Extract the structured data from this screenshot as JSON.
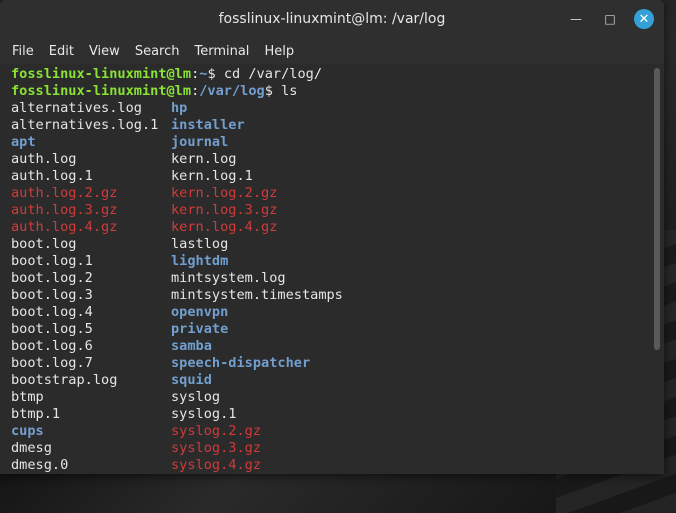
{
  "window": {
    "title": "fosslinux-linuxmint@lm: /var/log",
    "controls": {
      "minimize": "—",
      "maximize": "□",
      "close": "✕"
    }
  },
  "menu": [
    "File",
    "Edit",
    "View",
    "Search",
    "Terminal",
    "Help"
  ],
  "prompts": [
    {
      "user": "fosslinux-linuxmint@lm",
      "sep": ":",
      "path": "~",
      "symbol": "$ ",
      "command": "cd /var/log/"
    },
    {
      "user": "fosslinux-linuxmint@lm",
      "sep": ":",
      "path": "/var/log",
      "symbol": "$ ",
      "command": "ls"
    }
  ],
  "listing": [
    [
      {
        "name": "alternatives.log",
        "type": "file"
      },
      {
        "name": "hp",
        "type": "dir"
      }
    ],
    [
      {
        "name": "alternatives.log.1",
        "type": "file"
      },
      {
        "name": "installer",
        "type": "dir"
      }
    ],
    [
      {
        "name": "apt",
        "type": "dir"
      },
      {
        "name": "journal",
        "type": "dir"
      }
    ],
    [
      {
        "name": "auth.log",
        "type": "file"
      },
      {
        "name": "kern.log",
        "type": "file"
      }
    ],
    [
      {
        "name": "auth.log.1",
        "type": "file"
      },
      {
        "name": "kern.log.1",
        "type": "file"
      }
    ],
    [
      {
        "name": "auth.log.2.gz",
        "type": "gz"
      },
      {
        "name": "kern.log.2.gz",
        "type": "gz"
      }
    ],
    [
      {
        "name": "auth.log.3.gz",
        "type": "gz"
      },
      {
        "name": "kern.log.3.gz",
        "type": "gz"
      }
    ],
    [
      {
        "name": "auth.log.4.gz",
        "type": "gz"
      },
      {
        "name": "kern.log.4.gz",
        "type": "gz"
      }
    ],
    [
      {
        "name": "boot.log",
        "type": "file"
      },
      {
        "name": "lastlog",
        "type": "file"
      }
    ],
    [
      {
        "name": "boot.log.1",
        "type": "file"
      },
      {
        "name": "lightdm",
        "type": "dir"
      }
    ],
    [
      {
        "name": "boot.log.2",
        "type": "file"
      },
      {
        "name": "mintsystem.log",
        "type": "file"
      }
    ],
    [
      {
        "name": "boot.log.3",
        "type": "file"
      },
      {
        "name": "mintsystem.timestamps",
        "type": "file"
      }
    ],
    [
      {
        "name": "boot.log.4",
        "type": "file"
      },
      {
        "name": "openvpn",
        "type": "dir"
      }
    ],
    [
      {
        "name": "boot.log.5",
        "type": "file"
      },
      {
        "name": "private",
        "type": "dir"
      }
    ],
    [
      {
        "name": "boot.log.6",
        "type": "file"
      },
      {
        "name": "samba",
        "type": "dir"
      }
    ],
    [
      {
        "name": "boot.log.7",
        "type": "file"
      },
      {
        "name": "speech-dispatcher",
        "type": "dir"
      }
    ],
    [
      {
        "name": "bootstrap.log",
        "type": "file"
      },
      {
        "name": "squid",
        "type": "dir"
      }
    ],
    [
      {
        "name": "btmp",
        "type": "file"
      },
      {
        "name": "syslog",
        "type": "file"
      }
    ],
    [
      {
        "name": "btmp.1",
        "type": "file"
      },
      {
        "name": "syslog.1",
        "type": "file"
      }
    ],
    [
      {
        "name": "cups",
        "type": "dir"
      },
      {
        "name": "syslog.2.gz",
        "type": "gz"
      }
    ],
    [
      {
        "name": "dmesg",
        "type": "file"
      },
      {
        "name": "syslog.3.gz",
        "type": "gz"
      }
    ],
    [
      {
        "name": "dmesg.0",
        "type": "file"
      },
      {
        "name": "syslog.4.gz",
        "type": "gz"
      }
    ]
  ],
  "colors": {
    "prompt_user": "#8ae234",
    "prompt_path": "#729fcf",
    "directory": "#729fcf",
    "archive": "#d03b3b",
    "text": "#e5e5e5",
    "close_button": "#35a0d8"
  }
}
